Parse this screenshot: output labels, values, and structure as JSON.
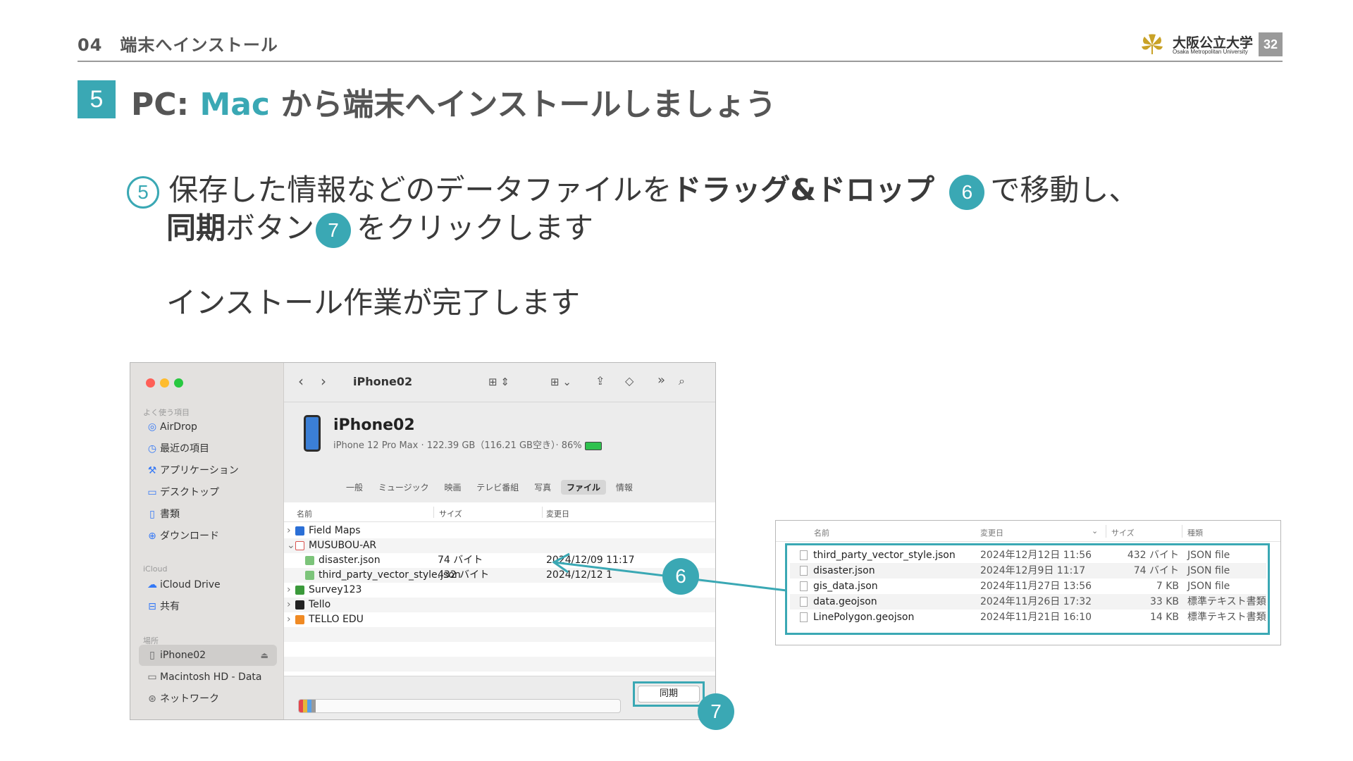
{
  "header": {
    "section": "04　端末へインストール",
    "logo_jp": "大阪公立大学",
    "logo_en": "Osaka Metropolitan University",
    "page_number": "32"
  },
  "step": {
    "number": "5",
    "title_prefix": "PC: ",
    "title_accent": "Mac",
    "title_suffix": " から端末へインストールしましょう"
  },
  "instructions": {
    "line1_num": "5",
    "line1_a": "保存した情報などのデータファイルを",
    "line1_bold": "ドラッグ&ドロップ",
    "line1_num2": "6",
    "line1_b": "で移動し、",
    "line2_bold": "同期",
    "line2_a": "ボタン",
    "line2_num": "7",
    "line2_b": "をクリックします",
    "line3": "インストール作業が完了します"
  },
  "finder": {
    "colors": {
      "close": "#ff5f57",
      "minimize": "#febc2e",
      "zoom": "#28c840"
    },
    "sidebar": {
      "favorites_label": "よく使う項目",
      "favorites": [
        {
          "icon": "airdrop-icon",
          "label": "AirDrop"
        },
        {
          "icon": "clock-icon",
          "label": "最近の項目"
        },
        {
          "icon": "apps-icon",
          "label": "アプリケーション"
        },
        {
          "icon": "desktop-icon",
          "label": "デスクトップ"
        },
        {
          "icon": "document-icon",
          "label": "書類"
        },
        {
          "icon": "download-icon",
          "label": "ダウンロード"
        }
      ],
      "icloud_label": "iCloud",
      "icloud": [
        {
          "icon": "cloud-icon",
          "label": "iCloud Drive"
        },
        {
          "icon": "shared-folder-icon",
          "label": "共有"
        }
      ],
      "locations_label": "場所",
      "locations": [
        {
          "icon": "phone-icon",
          "label": "iPhone02",
          "selected": true
        },
        {
          "icon": "disk-icon",
          "label": "Macintosh HD - Data"
        },
        {
          "icon": "network-icon",
          "label": "ネットワーク"
        }
      ]
    },
    "toolbar_title": "iPhone02",
    "device": {
      "name": "iPhone02",
      "info": "iPhone 12 Pro Max · 122.39 GB（116.21 GB空き）· 86%"
    },
    "tabs": [
      "一般",
      "ミュージック",
      "映画",
      "テレビ番組",
      "写真",
      "ファイル",
      "情報"
    ],
    "active_tab": "ファイル",
    "columns": {
      "name": "名前",
      "size": "サイズ",
      "modified": "変更日"
    },
    "rows": [
      {
        "chevron": "›",
        "name": "Field Maps",
        "size": "",
        "date": "",
        "color": "#2b6fd6"
      },
      {
        "chevron": "⌄",
        "name": "MUSUBOU-AR",
        "size": "",
        "date": "",
        "color": "#d9534f"
      },
      {
        "chevron": "",
        "name": "disaster.json",
        "size": "74 バイト",
        "date": "2024/12/09 11:17",
        "color": "#7cc47a"
      },
      {
        "chevron": "",
        "name": "third_party_vector_style.json",
        "size": "432 バイト",
        "date": "2024/12/12 1",
        "color": "#7cc47a"
      },
      {
        "chevron": "›",
        "name": "Survey123",
        "size": "",
        "date": "",
        "color": "#3b9a3b"
      },
      {
        "chevron": "›",
        "name": "Tello",
        "size": "",
        "date": "",
        "color": "#222222"
      },
      {
        "chevron": "›",
        "name": "TELLO EDU",
        "size": "",
        "date": "",
        "color": "#f08a24"
      }
    ],
    "sync_label": "同期"
  },
  "file_list": {
    "columns": {
      "name": "名前",
      "modified": "変更日",
      "size": "サイズ",
      "kind": "種類"
    },
    "rows": [
      {
        "name": "third_party_vector_style.json",
        "date": "2024年12月12日 11:56",
        "size": "432 バイト",
        "kind": "JSON file"
      },
      {
        "name": "disaster.json",
        "date": "2024年12月9日 11:17",
        "size": "74 バイト",
        "kind": "JSON file"
      },
      {
        "name": "gis_data.json",
        "date": "2024年11月27日 13:56",
        "size": "7 KB",
        "kind": "JSON file"
      },
      {
        "name": "data.geojson",
        "date": "2024年11月26日 17:32",
        "size": "33 KB",
        "kind": "標準テキスト書類"
      },
      {
        "name": "LinePolygon.geojson",
        "date": "2024年11月21日 16:10",
        "size": "14 KB",
        "kind": "標準テキスト書類"
      }
    ]
  },
  "callouts": {
    "drag": "6",
    "sync": "7"
  },
  "accent_color": "#3aa8b4"
}
